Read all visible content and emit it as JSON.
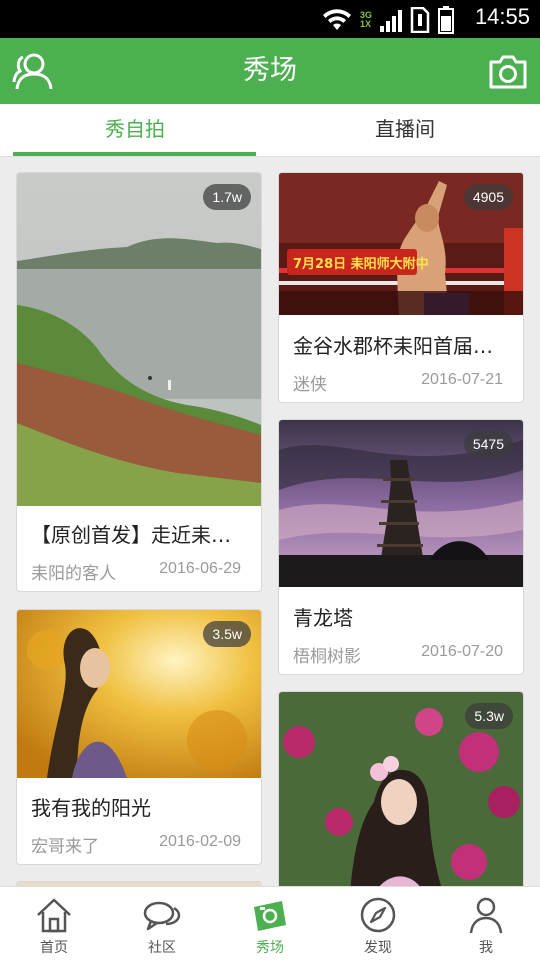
{
  "status_bar": {
    "time": "14:55",
    "network_top": "3G",
    "network_bottom": "1X",
    "icons": [
      "wifi-icon",
      "signal-icon",
      "sim-icon",
      "battery-icon"
    ]
  },
  "app_bar": {
    "title": "秀场",
    "left_icon": "user-icon",
    "right_icon": "camera-icon",
    "color": "#4caf50"
  },
  "tabs": [
    {
      "label": "秀自拍",
      "active": true
    },
    {
      "label": "直播间",
      "active": false
    }
  ],
  "feed": {
    "left": [
      {
        "title": "【原创首发】走近耒…",
        "author": "耒阳的客人",
        "date": "2016-06-29",
        "views": "1.7w",
        "image": "river-landscape"
      },
      {
        "title": "我有我的阳光",
        "author": "宏哥来了",
        "date": "2016-02-09",
        "views": "3.5w",
        "image": "girl-in-sunlight"
      }
    ],
    "right": [
      {
        "title": "金谷水郡杯耒阳首届…",
        "author": "迷侠",
        "date": "2016-07-21",
        "views": "4905",
        "image": "boxing-match",
        "image_text": {
          "banner": "7月28日 耒阳师大附中"
        }
      },
      {
        "title": "青龙塔",
        "author": "梧桐树影",
        "date": "2016-07-20",
        "views": "5475",
        "image": "pagoda-at-dusk"
      },
      {
        "title": "",
        "author": "",
        "date": "",
        "views": "5.3w",
        "image": "woman-with-flowers"
      }
    ]
  },
  "bottom_nav": [
    {
      "label": "首页",
      "icon": "home-icon",
      "active": false
    },
    {
      "label": "社区",
      "icon": "chat-icon",
      "active": false
    },
    {
      "label": "秀场",
      "icon": "show-icon",
      "active": true
    },
    {
      "label": "发现",
      "icon": "compass-icon",
      "active": false
    },
    {
      "label": "我",
      "icon": "profile-icon",
      "active": false
    }
  ]
}
